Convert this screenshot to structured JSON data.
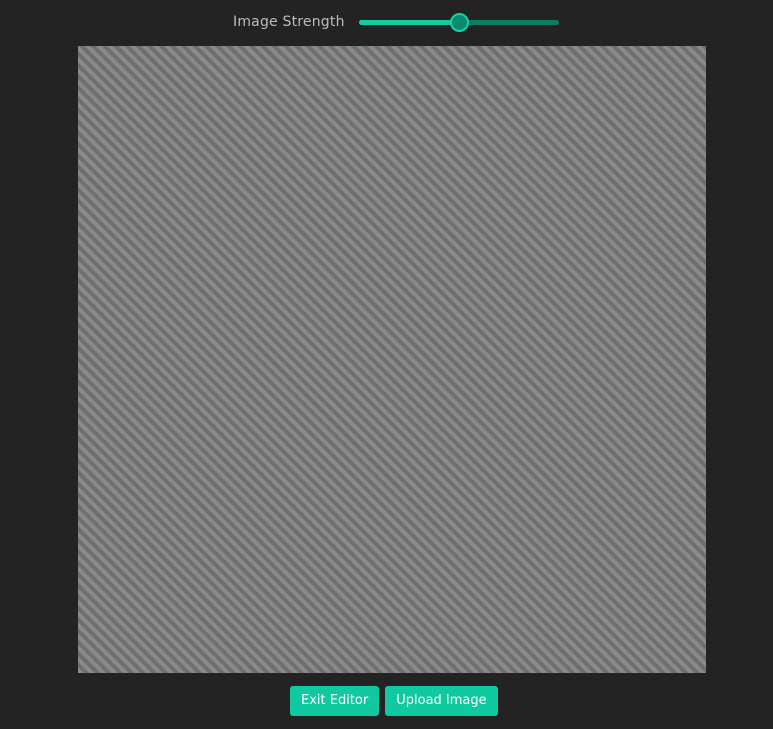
{
  "strength": {
    "label": "Image Strength",
    "value_fraction": 0.5
  },
  "actions": {
    "exit_label": "Exit Editor",
    "upload_label": "Upload Image"
  },
  "colors": {
    "accent": "#12cca2",
    "background": "#232323",
    "canvas": "#858585"
  }
}
